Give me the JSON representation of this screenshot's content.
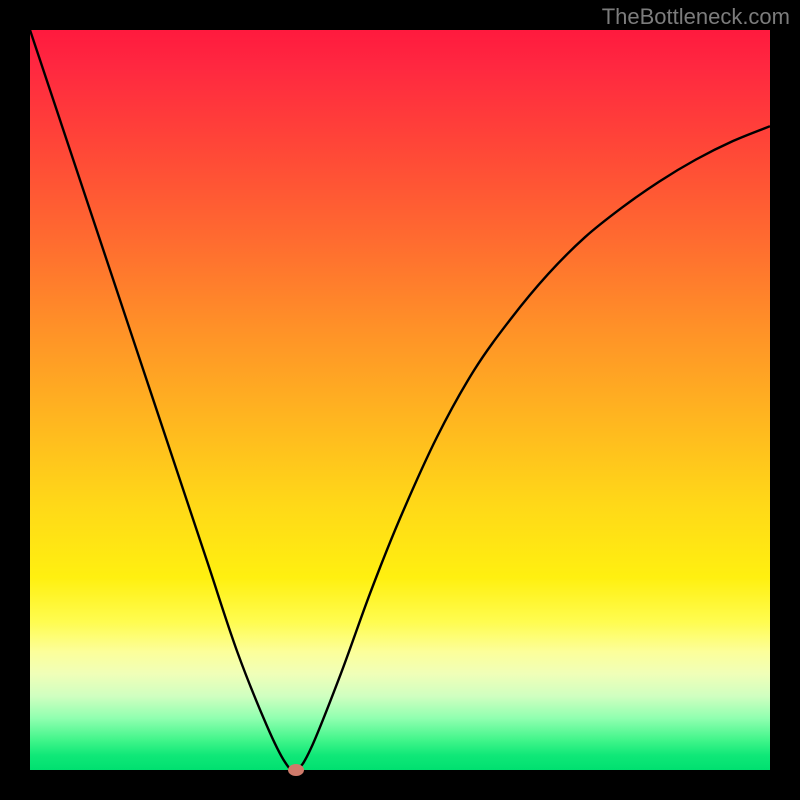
{
  "watermark": "TheBottleneck.com",
  "chart_data": {
    "type": "line",
    "title": "",
    "xlabel": "",
    "ylabel": "",
    "xlim": [
      0,
      100
    ],
    "ylim": [
      0,
      100
    ],
    "background_gradient": {
      "top": "#ff1a3e",
      "mid": "#ffd818",
      "bottom": "#00e070"
    },
    "series": [
      {
        "name": "bottleneck-curve",
        "x": [
          0,
          4,
          8,
          12,
          16,
          20,
          24,
          28,
          32,
          34.5,
          36,
          38,
          42,
          46,
          50,
          55,
          60,
          65,
          70,
          75,
          80,
          85,
          90,
          95,
          100
        ],
        "values": [
          100,
          88,
          76,
          64,
          52,
          40,
          28,
          16,
          6,
          1,
          0,
          3,
          13,
          24,
          34,
          45,
          54,
          61,
          67,
          72,
          76,
          79.5,
          82.5,
          85,
          87
        ],
        "color": "#000000"
      }
    ],
    "curve_minimum": {
      "x": 36.0,
      "y": 0.0
    },
    "marker_color": "#cf7a6a"
  }
}
